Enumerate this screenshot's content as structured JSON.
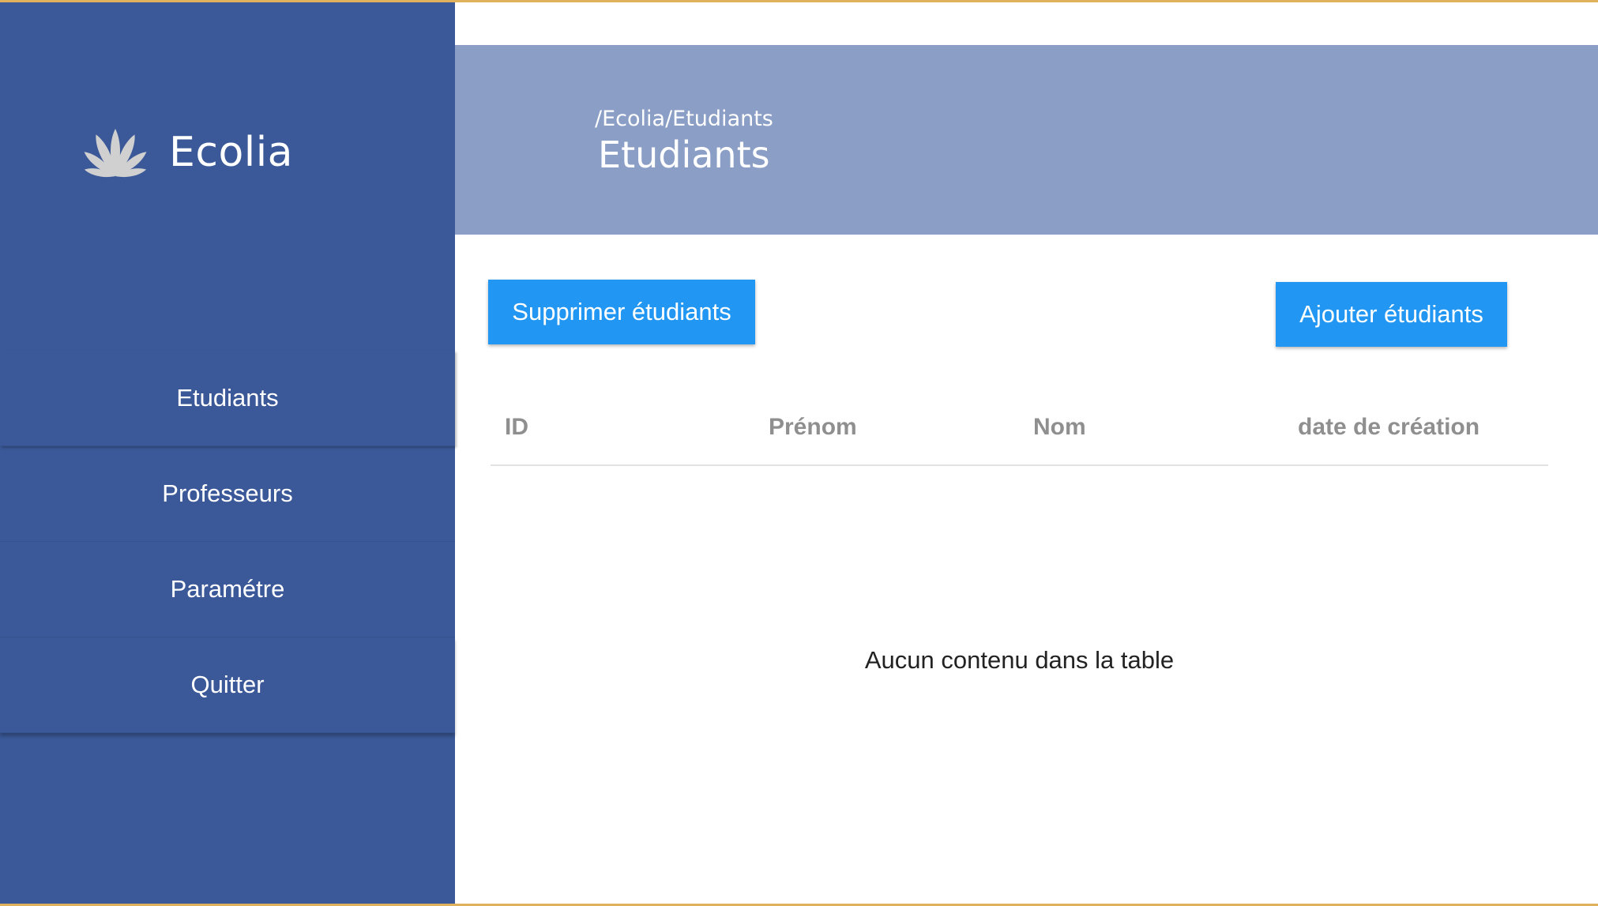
{
  "app": {
    "brand_name": "Ecolia",
    "logo_icon": "fan-petals-icon",
    "colors": {
      "sidebar": "#3b5998",
      "header": "#8b9ec6",
      "accent": "#2196f3",
      "frame": "#e0b15c"
    }
  },
  "sidebar": {
    "items": [
      {
        "label": "Etudiants"
      },
      {
        "label": "Professeurs"
      },
      {
        "label": "Paramétre"
      },
      {
        "label": "Quitter"
      }
    ]
  },
  "header": {
    "breadcrumb": "/Ecolia/Etudiants",
    "title": "Etudiants"
  },
  "toolbar": {
    "delete_label": "Supprimer étudiants",
    "add_label": "Ajouter étudiants"
  },
  "table": {
    "columns": [
      "ID",
      "Prénom",
      "Nom",
      "date de création"
    ],
    "rows": [],
    "empty_message": "Aucun contenu dans la table"
  }
}
